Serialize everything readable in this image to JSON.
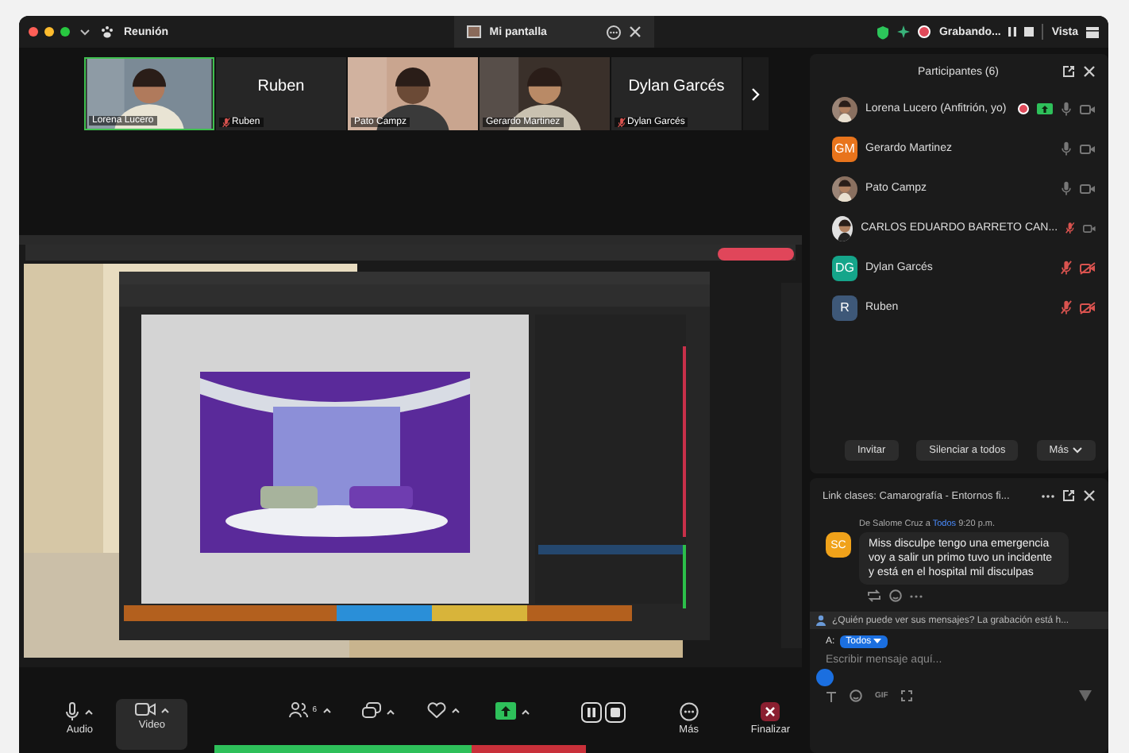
{
  "title_bar": {
    "meeting_label": "Reunión",
    "share_tab": {
      "label": "Mi pantalla"
    },
    "recording": {
      "label": "Grabando..."
    },
    "view_label": "Vista"
  },
  "video_strip": [
    {
      "kind": "video",
      "name": "Lorena Lucero",
      "muted": false,
      "active": true
    },
    {
      "kind": "name",
      "display_name": "Ruben",
      "name": "Ruben",
      "muted": true,
      "active": false
    },
    {
      "kind": "video",
      "name": "Pato Campz",
      "muted": false,
      "active": false
    },
    {
      "kind": "video",
      "name": "Gerardo Martinez",
      "muted": false,
      "active": false
    },
    {
      "kind": "name",
      "display_name": "Dylan Garcés",
      "name": "Dylan Garcés",
      "muted": true,
      "active": false
    }
  ],
  "participants": {
    "title": "Participantes (6)",
    "items": [
      {
        "name": "Lorena Lucero (Anfitrión, yo)",
        "recording": true,
        "sharing": true,
        "mic_muted": false,
        "video_off": false
      },
      {
        "name": "Gerardo Martinez",
        "avatar": {
          "kind": "initials",
          "initials": "GM",
          "color": "#e8741c"
        },
        "recording": false,
        "sharing": false,
        "mic_muted": false,
        "video_off": false
      },
      {
        "name": "Pato Campz",
        "recording": false,
        "sharing": false,
        "mic_muted": false,
        "video_off": false
      },
      {
        "name": "CARLOS EDUARDO BARRETO CAN...",
        "recording": false,
        "sharing": false,
        "mic_muted": true,
        "video_off": false
      },
      {
        "name": "Dylan Garcés",
        "avatar": {
          "kind": "initials",
          "initials": "DG",
          "color": "#15a58a"
        },
        "recording": false,
        "sharing": false,
        "mic_muted": true,
        "video_off": true
      },
      {
        "name": "Ruben",
        "avatar": {
          "kind": "initials",
          "initials": "R",
          "color": "#3e5878"
        },
        "recording": false,
        "sharing": false,
        "mic_muted": true,
        "video_off": true
      }
    ],
    "buttons": [
      {
        "label": "Invitar"
      },
      {
        "label": "Silenciar a todos"
      },
      {
        "label": "Más",
        "dropdown": true
      }
    ]
  },
  "chat": {
    "title": "Link clases: Camarografía - Entornos fi...",
    "messages": [
      {
        "initials": "SC",
        "color": "#f0a21a",
        "from": "De Salome Cruz a",
        "to": "Todos",
        "time": "9:20 p.m.",
        "text": "Miss disculpe tengo una emergencia voy a salir un primo tuvo un incidente y está en el hospital mil disculpas"
      }
    ],
    "notice": "¿Quién puede ver sus mensajes? La grabación está h...",
    "recipient_label": "A:",
    "recipient": "Todos",
    "placeholder": "Escribir mensaje aquí...",
    "gif_label": "GIF"
  },
  "toolbar": [
    {
      "kind": "audio",
      "label": "Audio",
      "selected": false
    },
    {
      "kind": "video",
      "label": "Video",
      "selected": true
    },
    {
      "kind": "participants",
      "count": "6",
      "selected": false
    },
    {
      "kind": "chat",
      "selected": false
    },
    {
      "kind": "reactions",
      "selected": false
    },
    {
      "kind": "share",
      "selected": false
    },
    {
      "kind": "record",
      "selected": false
    },
    {
      "kind": "more",
      "label": "Más",
      "selected": false
    },
    {
      "kind": "end",
      "label": "Finalizar",
      "selected": false
    }
  ]
}
